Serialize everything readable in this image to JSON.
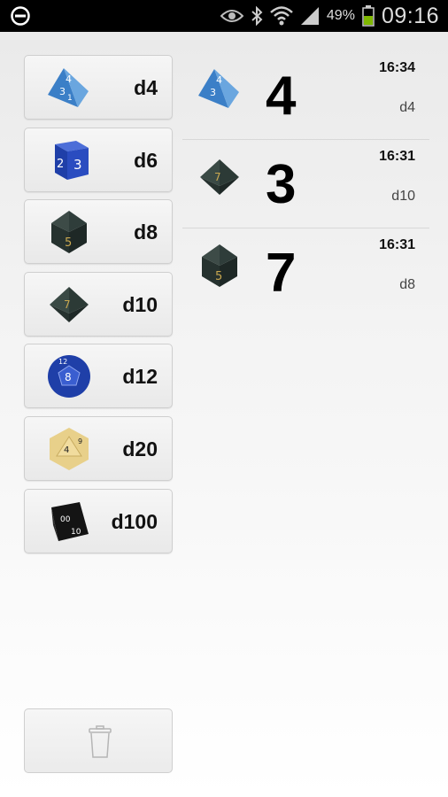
{
  "status_bar": {
    "battery_percent": "49%",
    "time": "09:16",
    "icons": [
      "do-not-disturb-icon",
      "eye-icon",
      "bluetooth-icon",
      "wifi-icon",
      "signal-icon",
      "battery-icon"
    ]
  },
  "dice": [
    {
      "label": "d4",
      "icon": "d4-die-icon"
    },
    {
      "label": "d6",
      "icon": "d6-die-icon"
    },
    {
      "label": "d8",
      "icon": "d8-die-icon"
    },
    {
      "label": "d10",
      "icon": "d10-die-icon"
    },
    {
      "label": "d12",
      "icon": "d12-die-icon"
    },
    {
      "label": "d20",
      "icon": "d20-die-icon"
    },
    {
      "label": "d100",
      "icon": "d100-die-icon"
    }
  ],
  "clear_button": {
    "icon": "trash-icon"
  },
  "history": [
    {
      "result": "4",
      "time": "16:34",
      "die": "d4"
    },
    {
      "result": "3",
      "time": "16:31",
      "die": "d10"
    },
    {
      "result": "7",
      "time": "16:31",
      "die": "d8"
    }
  ],
  "colors": {
    "blue_die": "#3b7fc7",
    "navy_die": "#1f3fa8",
    "dark_green_die": "#2f3d3a",
    "ivory_die": "#e8d08a",
    "black_die": "#141414",
    "gold_numerals": "#c9a850"
  }
}
